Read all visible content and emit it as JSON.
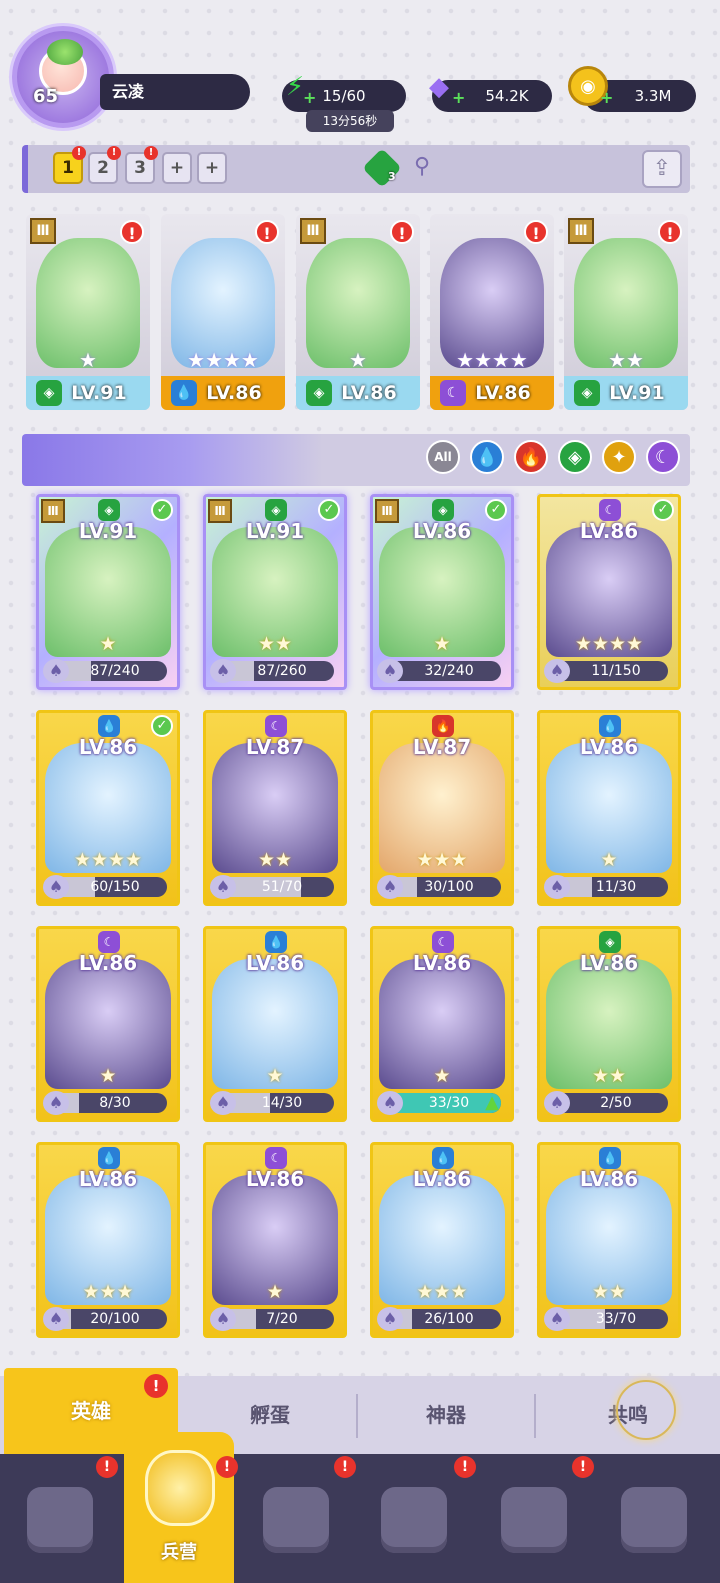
{
  "player": {
    "level": "65",
    "name": "云凌"
  },
  "resources": {
    "energy": "15/60",
    "energy_timer": "13分56秒",
    "gems": "54.2K",
    "gold": "3.3M"
  },
  "teams": {
    "tabs": [
      "1",
      "2",
      "3",
      "+",
      "+"
    ],
    "active_tab": "1",
    "element_count": "3"
  },
  "team_heroes": [
    {
      "level": "LV.91",
      "stars": "★",
      "element": "nature",
      "bar": "#9ad9f0"
    },
    {
      "level": "LV.86",
      "stars": "★★★★",
      "element": "water",
      "bar": "#f0a10e"
    },
    {
      "level": "LV.86",
      "stars": "★",
      "element": "nature",
      "bar": "#9ad9f0"
    },
    {
      "level": "LV.86",
      "stars": "★★★★",
      "element": "dark",
      "bar": "#f0a10e"
    },
    {
      "level": "LV.91",
      "stars": "★★",
      "element": "nature",
      "bar": "#9ad9f0"
    }
  ],
  "filters": [
    {
      "label": "All",
      "color": "#8a8794"
    },
    {
      "label": "💧",
      "color": "#2a7fd6"
    },
    {
      "label": "🔥",
      "color": "#d8352a"
    },
    {
      "label": "◈",
      "color": "#27a340"
    },
    {
      "label": "✦",
      "color": "#e0a10e"
    },
    {
      "label": "☾",
      "color": "#8d4fd6"
    }
  ],
  "heroes": [
    {
      "level": "LV.91",
      "progress": "87/240",
      "stars": "★",
      "element": "nature"
    },
    {
      "level": "LV.91",
      "progress": "87/260",
      "stars": "★★",
      "element": "nature"
    },
    {
      "level": "LV.86",
      "progress": "32/240",
      "stars": "★",
      "element": "nature"
    },
    {
      "level": "LV.86",
      "progress": "11/150",
      "stars": "★★★★",
      "element": "dark"
    },
    {
      "level": "LV.86",
      "progress": "60/150",
      "stars": "★★★★",
      "element": "water"
    },
    {
      "level": "LV.87",
      "progress": "51/70",
      "stars": "★★",
      "element": "dark"
    },
    {
      "level": "LV.87",
      "progress": "30/100",
      "stars": "★★★",
      "element": "fire"
    },
    {
      "level": "LV.86",
      "progress": "11/30",
      "stars": "★",
      "element": "water"
    },
    {
      "level": "LV.86",
      "progress": "8/30",
      "stars": "★",
      "element": "dark"
    },
    {
      "level": "LV.86",
      "progress": "14/30",
      "stars": "★",
      "element": "water"
    },
    {
      "level": "LV.86",
      "progress": "33/30",
      "stars": "★",
      "element": "dark"
    },
    {
      "level": "LV.86",
      "progress": "2/50",
      "stars": "★★",
      "element": "nature"
    },
    {
      "level": "LV.86",
      "progress": "20/100",
      "stars": "★★★",
      "element": "water"
    },
    {
      "level": "LV.86",
      "progress": "7/20",
      "stars": "★",
      "element": "dark"
    },
    {
      "level": "LV.86",
      "progress": "26/100",
      "stars": "★★★",
      "element": "water"
    },
    {
      "level": "LV.86",
      "progress": "33/70",
      "stars": "★★",
      "element": "water"
    }
  ],
  "subtabs": {
    "heroes": "英雄",
    "eggs": "孵蛋",
    "artifacts": "神器",
    "resonance": "共鸣"
  },
  "nav": {
    "active_label": "兵营"
  },
  "colors": {
    "nature": "#27a340",
    "water": "#2a7fd6",
    "fire": "#d8352a",
    "dark": "#8d4fd6",
    "light": "#e0a10e"
  }
}
